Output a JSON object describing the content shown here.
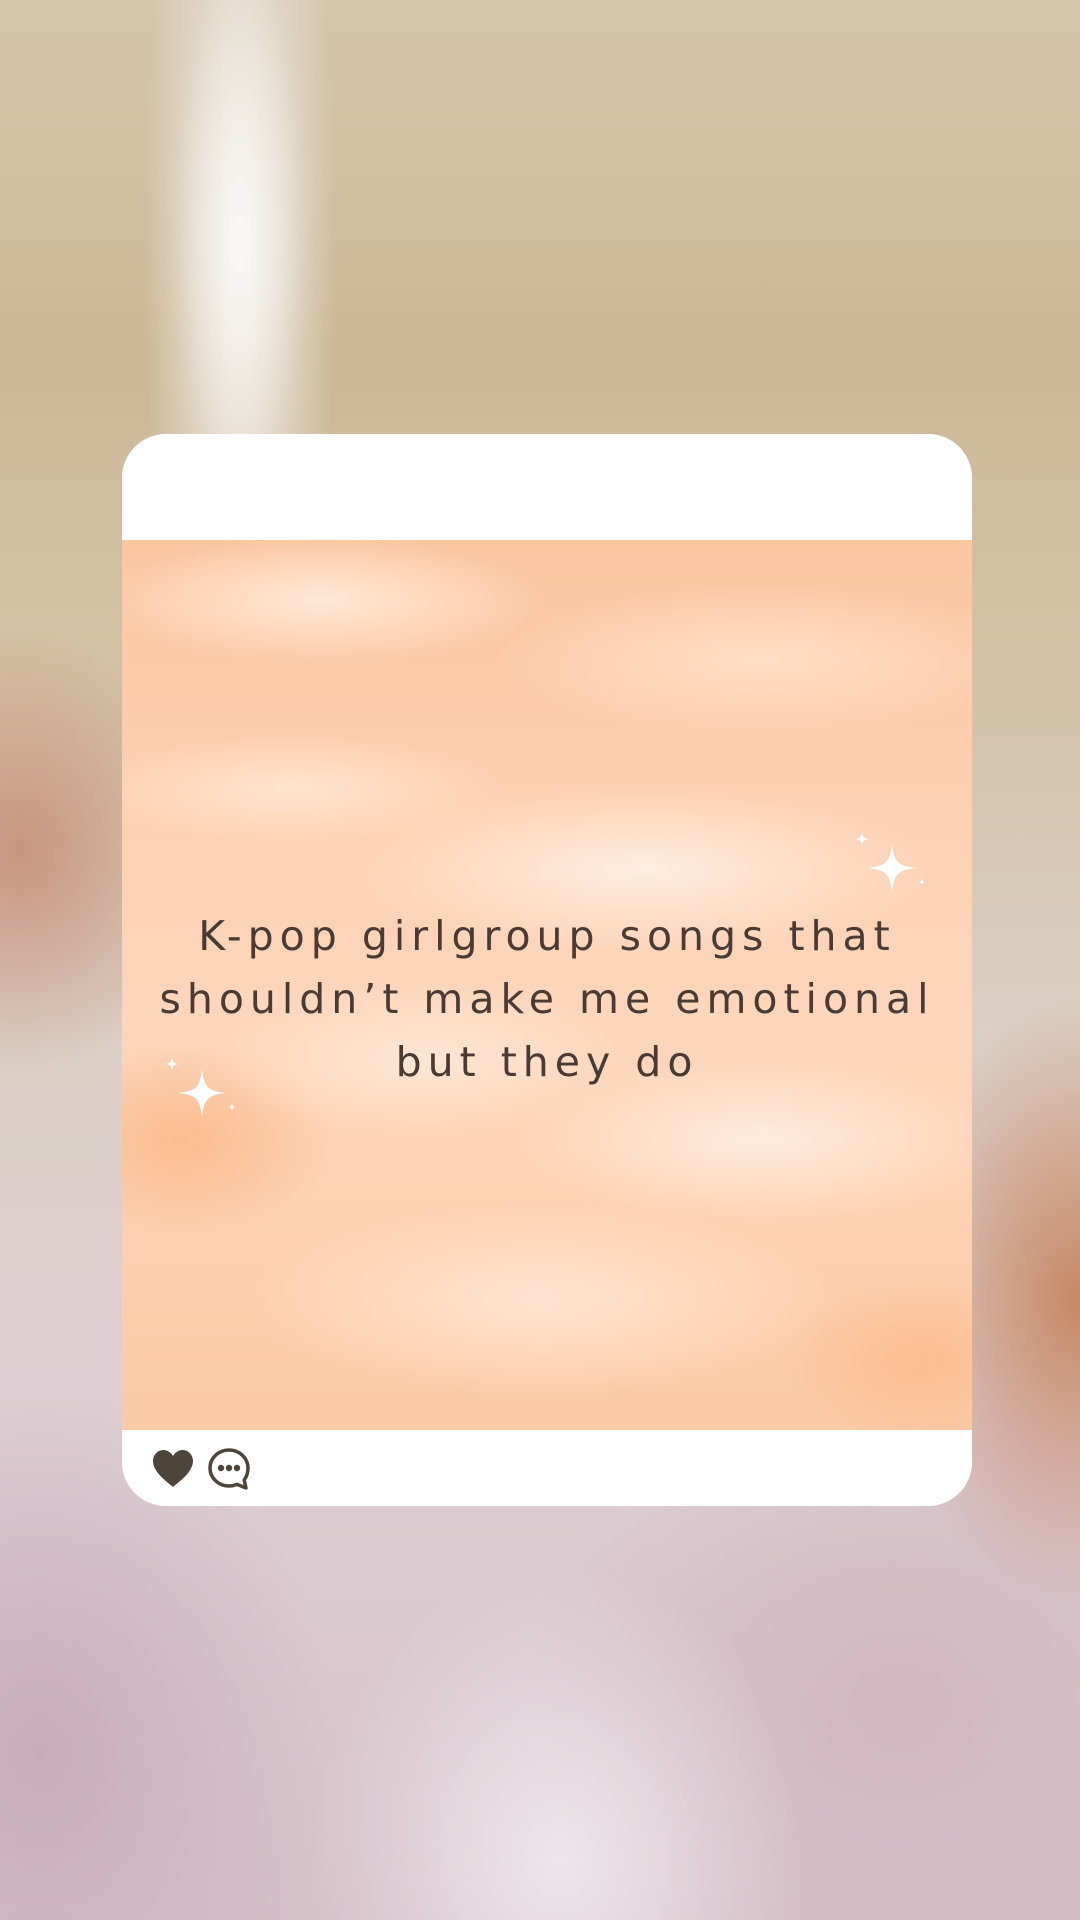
{
  "post": {
    "text_lines": [
      "K-pop girlgroup songs that",
      "shouldn’t make me emotional",
      "but they do"
    ]
  },
  "actions": {
    "like_icon": "heart-icon",
    "comment_icon": "chat-bubble-icon"
  },
  "colors": {
    "text": "#4a3a32",
    "icon": "#4d443a",
    "card": "#ffffff",
    "image_peach": "#fcd0b2"
  }
}
